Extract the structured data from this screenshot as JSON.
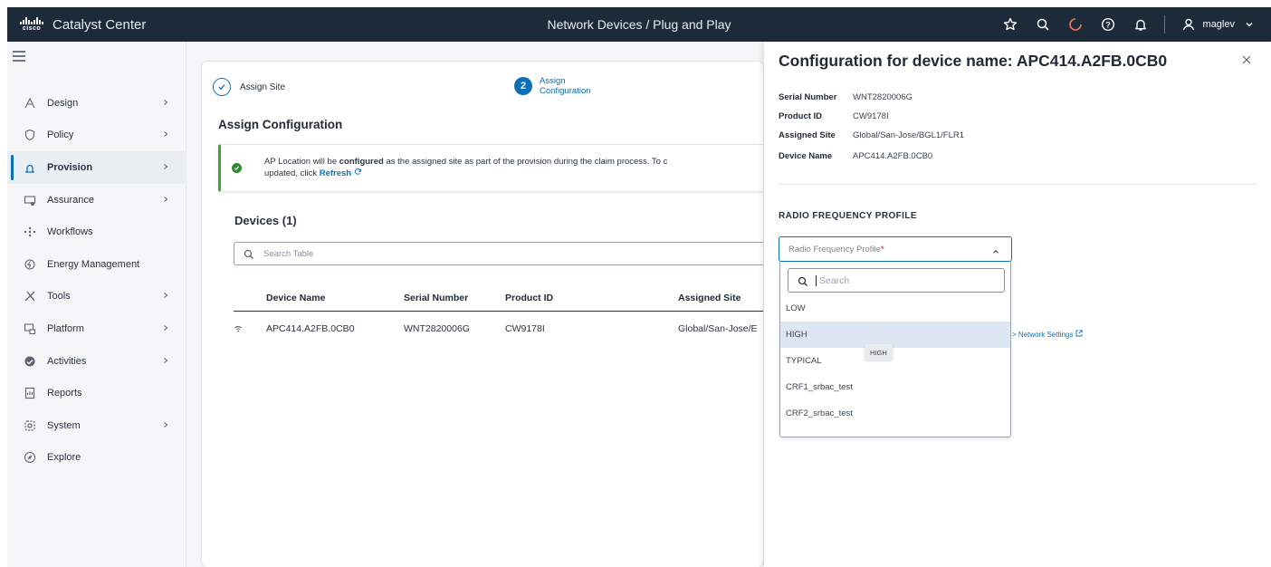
{
  "app": {
    "logo_text": "cisco",
    "name": "Catalyst Center",
    "page_path": "Network Devices / Plug and Play",
    "user": "maglev"
  },
  "topbar_icons": [
    "star-icon",
    "search-icon",
    "cloud-icon",
    "help-icon",
    "bell-icon",
    "user-icon",
    "chevron-down-icon"
  ],
  "sidebar": {
    "items": [
      {
        "label": "Design",
        "icon": "design-icon",
        "chevron": true,
        "active": false
      },
      {
        "label": "Policy",
        "icon": "shield-icon",
        "chevron": true,
        "active": false
      },
      {
        "label": "Provision",
        "icon": "provision-icon",
        "chevron": true,
        "active": true
      },
      {
        "label": "Assurance",
        "icon": "assurance-icon",
        "chevron": true,
        "active": false
      },
      {
        "label": "Workflows",
        "icon": "workflows-icon",
        "chevron": false,
        "active": false
      },
      {
        "label": "Energy Management",
        "icon": "energy-icon",
        "chevron": false,
        "active": false
      },
      {
        "label": "Tools",
        "icon": "tools-icon",
        "chevron": true,
        "active": false
      },
      {
        "label": "Platform",
        "icon": "platform-icon",
        "chevron": true,
        "active": false
      },
      {
        "label": "Activities",
        "icon": "activities-icon",
        "chevron": true,
        "active": false
      },
      {
        "label": "Reports",
        "icon": "reports-icon",
        "chevron": false,
        "active": false
      },
      {
        "label": "System",
        "icon": "gear-icon",
        "chevron": true,
        "active": false
      },
      {
        "label": "Explore",
        "icon": "explore-icon",
        "chevron": false,
        "active": false
      }
    ]
  },
  "wizard": {
    "step1_label": "Assign Site",
    "step2_number": "2",
    "step2_label": "Assign Configuration",
    "section_title": "Assign Configuration",
    "alert": {
      "text_before": "AP Location will be ",
      "text_bold": "configured",
      "text_after": " as the assigned site as part of the provision during the claim process. To c",
      "line2_before": "updated, click ",
      "link": "Refresh"
    },
    "devices_title": "Devices (1)",
    "search_placeholder": "Search Table",
    "columns": [
      "Device Name",
      "Serial Number",
      "Product ID",
      "Assigned Site"
    ],
    "rows": [
      {
        "device_name": "APC414.A2FB.0CB0",
        "serial": "WNT2820006G",
        "product_id": "CW9178I",
        "site": "Global/San-Jose/E"
      }
    ]
  },
  "panel": {
    "title": "Configuration for device name: APC414.A2FB.0CB0",
    "fields": [
      {
        "key": "Serial Number",
        "value": "WNT2820006G"
      },
      {
        "key": "Product ID",
        "value": "CW9178I"
      },
      {
        "key": "Assigned Site",
        "value": "Global/San-Jose/BGL1/FLR1"
      },
      {
        "key": "Device Name",
        "value": "APC414.A2FB.0CB0"
      }
    ],
    "rf_heading": "RADIO FREQUENCY PROFILE",
    "rf_placeholder": "Radio Frequency Profile",
    "rf_required_mark": "*",
    "dropdown_search_placeholder": "Search",
    "options": [
      "LOW",
      "HIGH",
      "TYPICAL",
      "CRF1_srbac_test",
      "CRF2_srbac_test"
    ],
    "hovered_option": "HIGH",
    "tooltip": "HIGH",
    "network_settings_link": "> Network Settings"
  },
  "colors": {
    "topbar": "#1c2a3a",
    "accent": "#0d6fb8",
    "success": "#3aa53a",
    "hover": "#dde7f3"
  }
}
